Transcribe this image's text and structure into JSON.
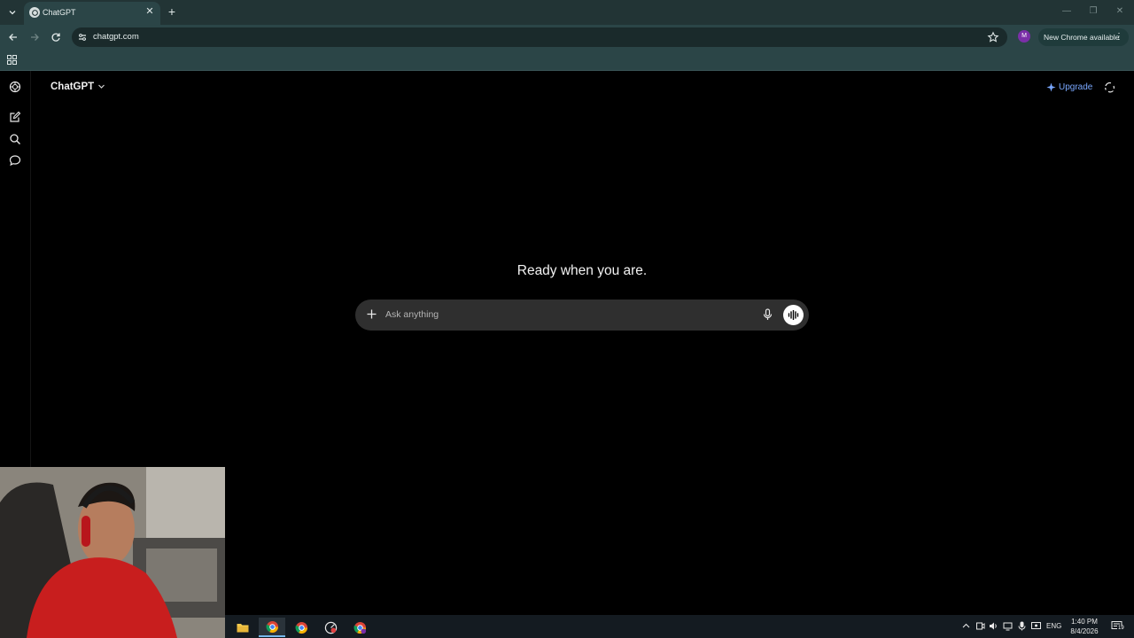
{
  "browser": {
    "tab": {
      "title": "ChatGPT"
    },
    "address": {
      "url": "chatgpt.com"
    },
    "profile_initial": "M",
    "update_label": "New Chrome available"
  },
  "chatgpt": {
    "model_label": "ChatGPT",
    "upgrade_label": "Upgrade",
    "headline": "Ready when you are.",
    "composer": {
      "placeholder": "Ask anything"
    },
    "rail_icons": [
      "openai-logo-icon",
      "new-chat-icon",
      "search-chats-icon",
      "chat-bubble-icon"
    ]
  },
  "taskbar": {
    "apps": [
      "file-explorer-icon",
      "chrome-profile-1-icon",
      "chrome-profile-2-icon",
      "app-icon",
      "chrome-profile-3-icon"
    ],
    "language": "ENG",
    "time": "1:40 PM",
    "date": "8/4/2026",
    "notification_count": "19"
  },
  "colors": {
    "browser_frame": "#223435",
    "toolbar": "#2b4547",
    "page_bg": "#000000",
    "composer_bg": "#2f2f2f",
    "upgrade_accent": "#7aa8ff",
    "taskbar": "#141b21"
  }
}
